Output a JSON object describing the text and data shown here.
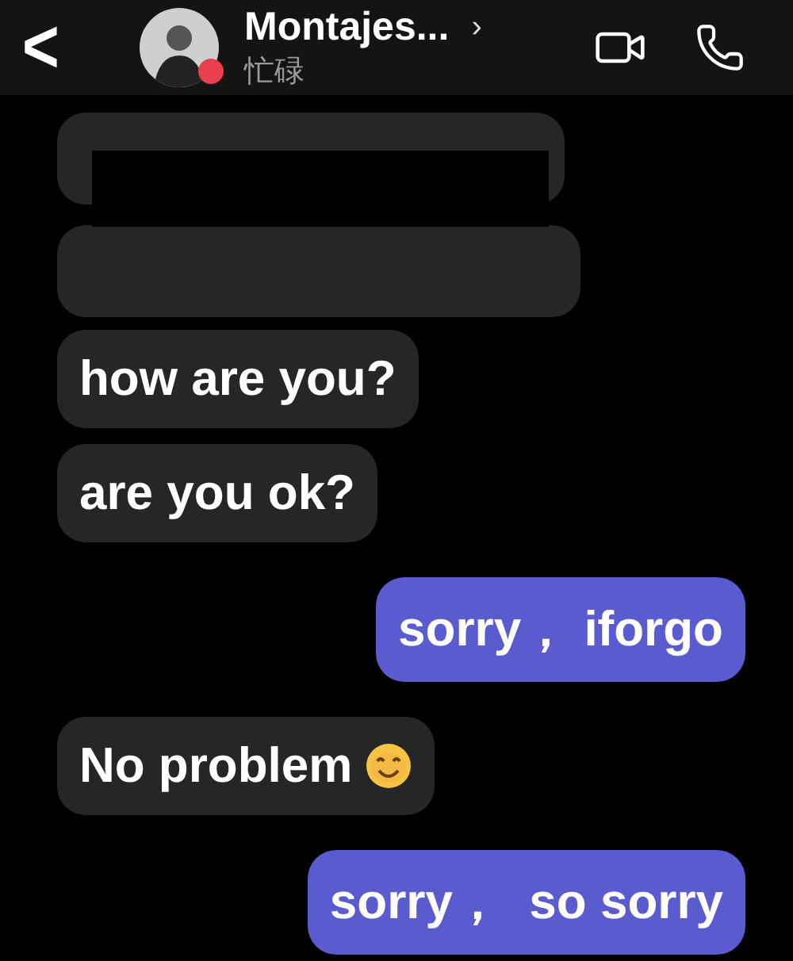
{
  "header": {
    "back": "<",
    "name": "Montajes...",
    "chevron": "›",
    "status": "忙碌",
    "busy": true
  },
  "messages": [
    {
      "kind": "received",
      "redacted": true
    },
    {
      "kind": "received",
      "redacted": true
    },
    {
      "kind": "received",
      "text": "how are you?"
    },
    {
      "kind": "received",
      "text": "are you ok?"
    },
    {
      "kind": "sent",
      "text": "sorry， iforgo"
    },
    {
      "kind": "received",
      "text": "No problem",
      "emoji": true
    },
    {
      "kind": "sent",
      "text": "sorry，  so sorry"
    }
  ]
}
